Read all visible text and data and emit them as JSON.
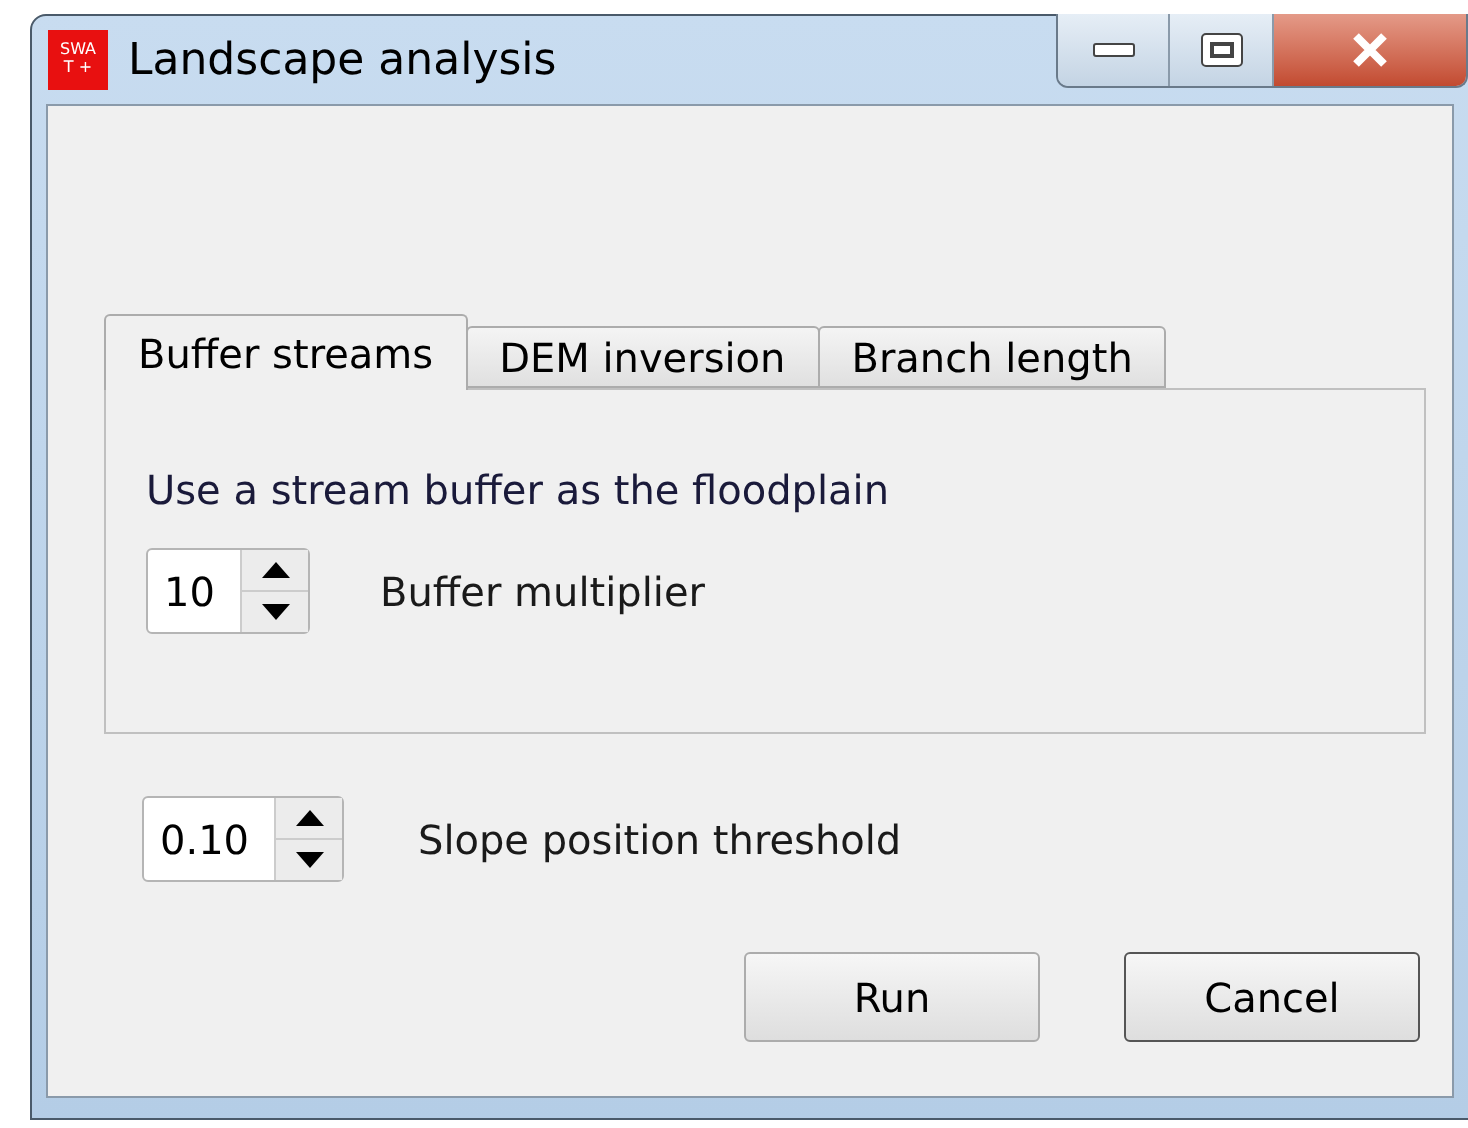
{
  "window": {
    "title": "Landscape analysis",
    "icon_text": "SWAT +"
  },
  "tabs": [
    {
      "label": "Buffer streams",
      "selected": true
    },
    {
      "label": "DEM inversion",
      "selected": false
    },
    {
      "label": "Branch length",
      "selected": false
    }
  ],
  "tab_pane": {
    "heading": "Use a stream buffer as the floodplain",
    "spinbox": {
      "value": "10",
      "label": "Buffer multiplier"
    }
  },
  "slope_spinbox": {
    "value": "0.10",
    "label": "Slope position threshold"
  },
  "buttons": [
    {
      "label": "Run",
      "kind": "default"
    },
    {
      "label": "Cancel",
      "kind": "focused"
    }
  ]
}
